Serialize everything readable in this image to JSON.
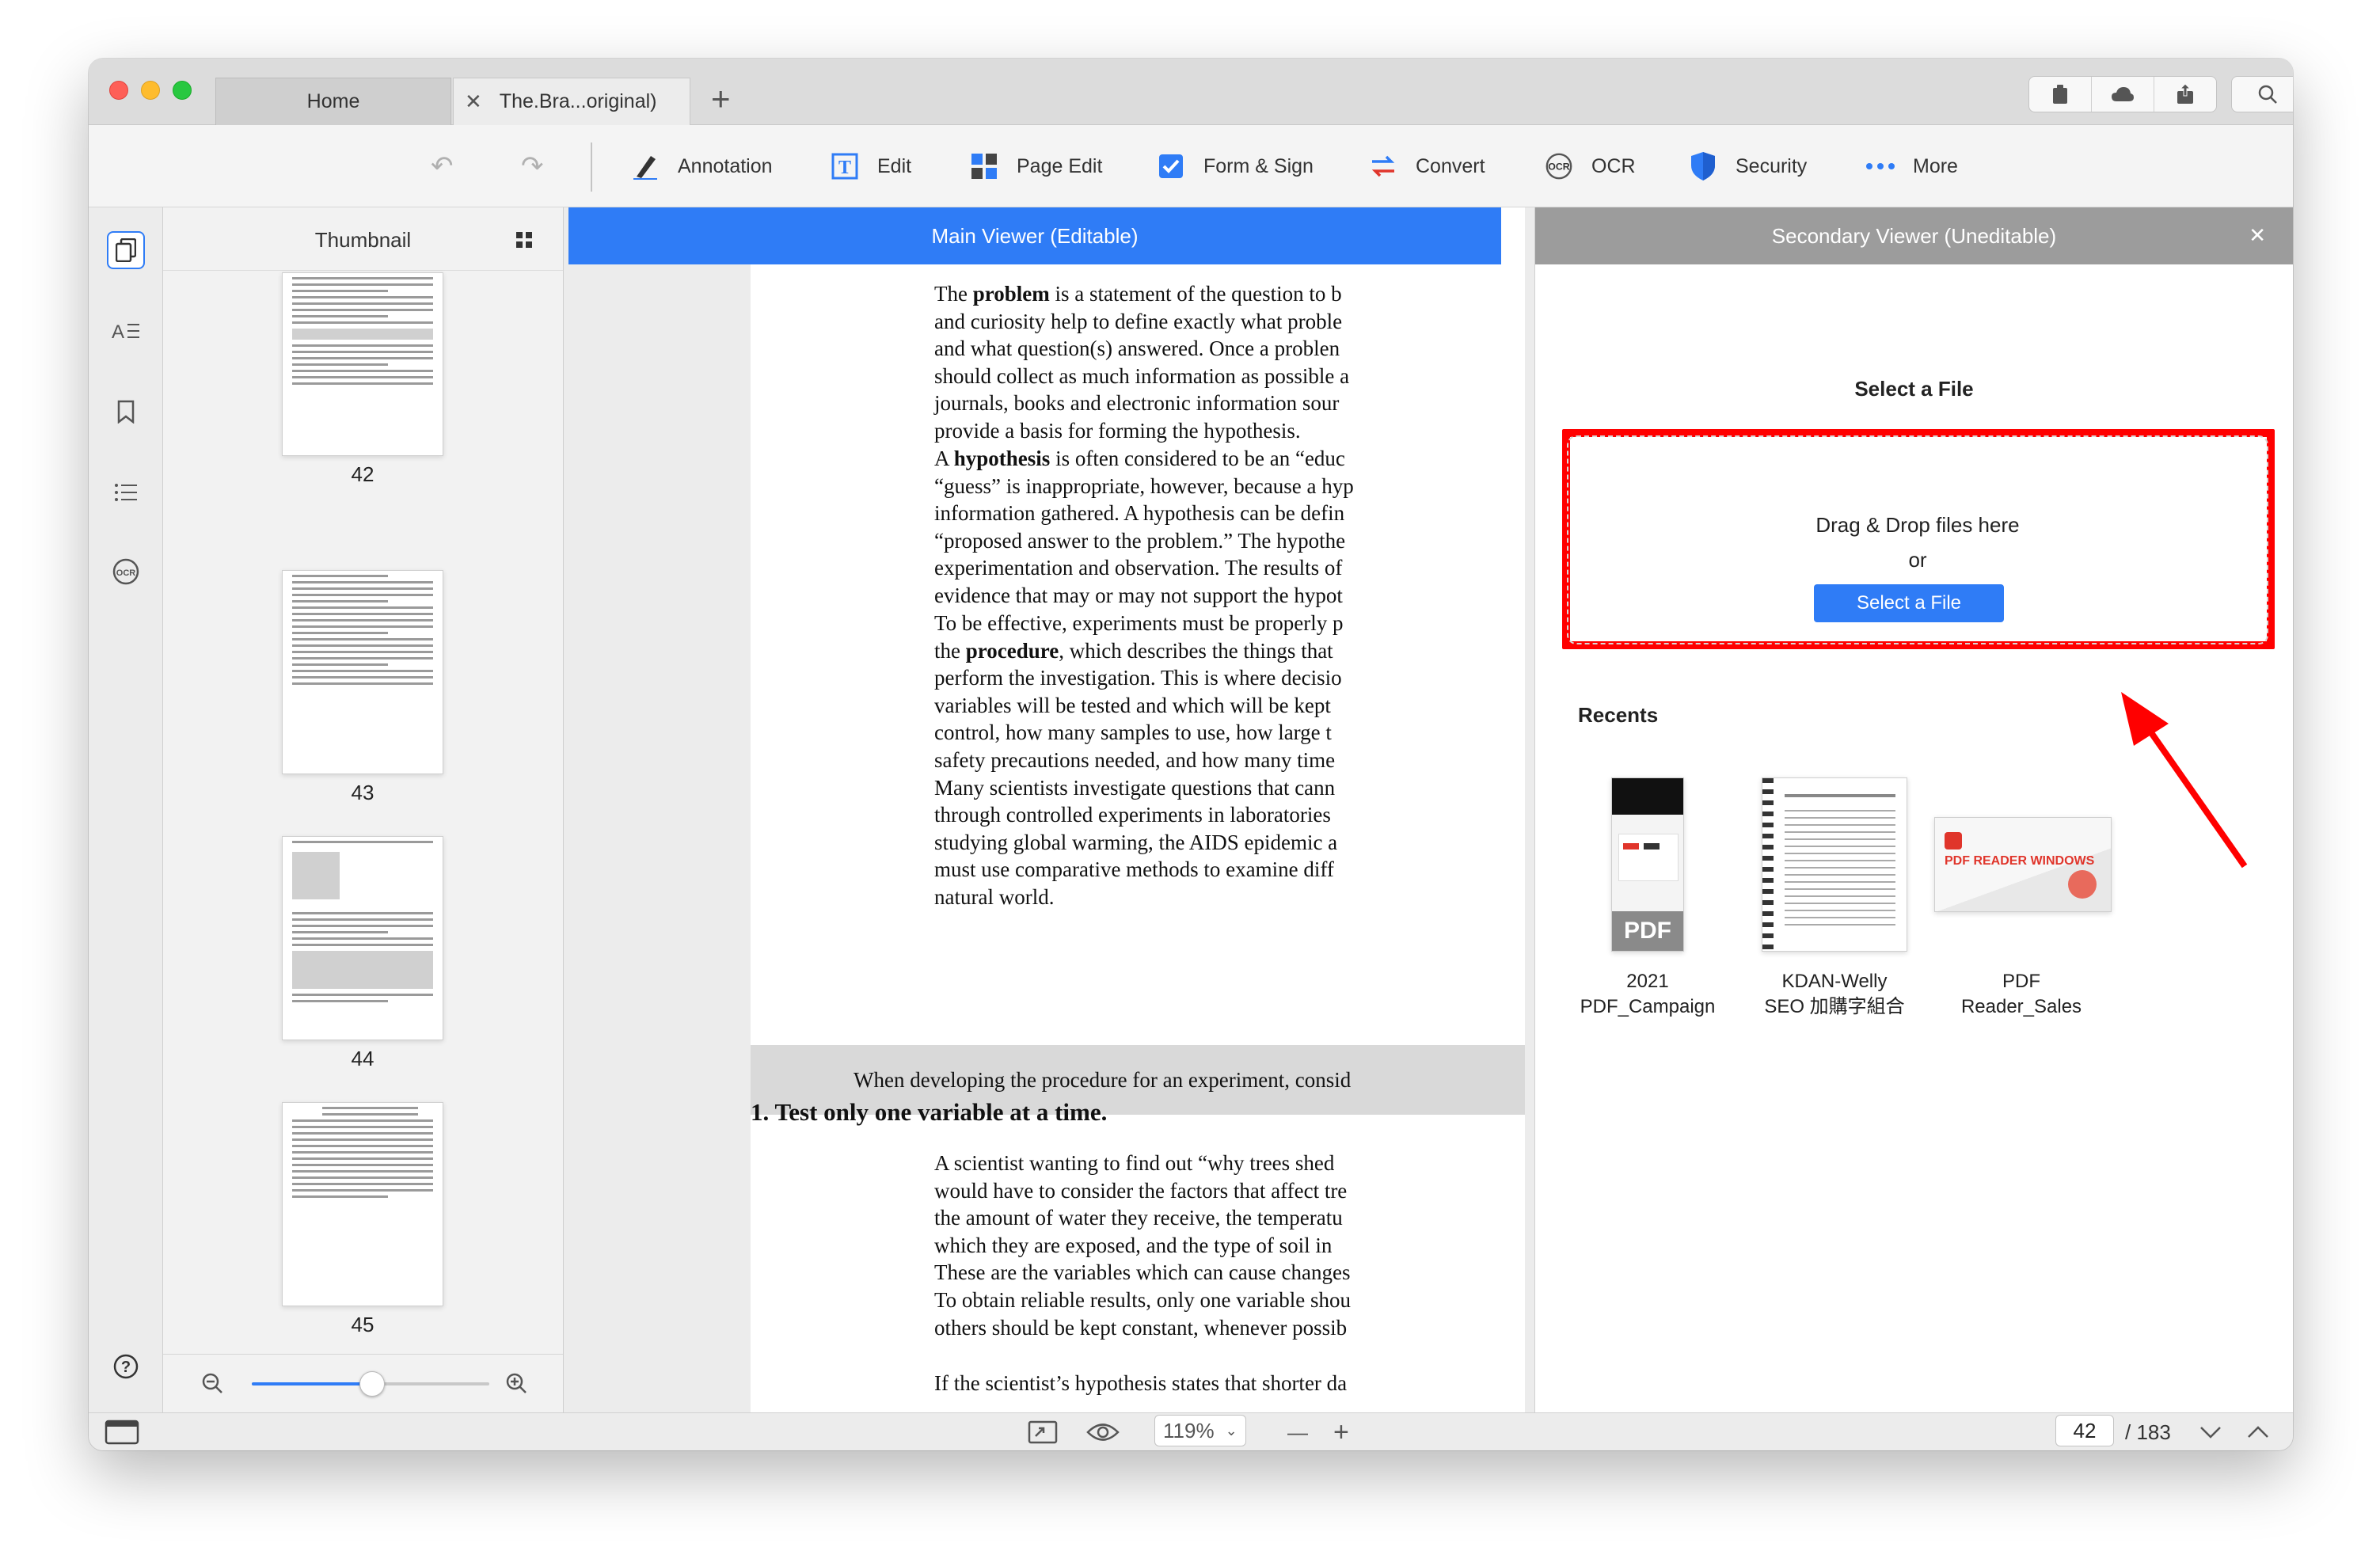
{
  "tabs": {
    "home": "Home",
    "document": "The.Bra...original)"
  },
  "toolbar": {
    "annotation": "Annotation",
    "edit": "Edit",
    "page_edit": "Page Edit",
    "form_sign": "Form & Sign",
    "convert": "Convert",
    "ocr": "OCR",
    "security": "Security",
    "more": "More"
  },
  "thumbnail_panel": {
    "title": "Thumbnail",
    "pages": [
      "42",
      "43",
      "44",
      "45"
    ]
  },
  "main_viewer": {
    "header": "Main Viewer (Editable)",
    "p1": [
      "The problem is a statement of the question to b",
      "and curiosity help to define exactly what proble",
      "and what question(s) answered. Once a problen",
      "should collect as much information as possible a",
      "journals, books and electronic information sour",
      "provide a basis for forming the hypothesis."
    ],
    "p2": [
      "A hypothesis is often considered to be an “educ",
      "“guess” is inappropriate, however, because a hyp",
      "information gathered. A hypothesis can be defin",
      "“proposed answer to the problem.” The hypothe",
      "experimentation and observation. The results of",
      "evidence that may or may not support the hypot"
    ],
    "p3": [
      "To be effective, experiments must be properly p",
      "the procedure, which describes the things that",
      "perform the investigation. This is where decisio",
      "variables will be tested and which will be kept",
      "control, how many samples to use, how large t",
      "safety precautions needed, and how many time",
      "Many scientists investigate questions that cann",
      "through controlled experiments in laboratories",
      "studying global warming, the AIDS epidemic a",
      "must use comparative methods to examine diff",
      "natural world."
    ],
    "callout": "When developing the procedure for an experiment, consid",
    "heading": "1.  Test only one variable at a time.",
    "p4": [
      "A scientist wanting to find out “why trees shed",
      "would have to consider the factors that affect tre",
      "the amount of water they receive, the temperatu",
      "which they are exposed, and the type of soil in",
      "These are the variables which can cause changes",
      "To obtain reliable results, only one variable shou",
      "others should be kept constant, whenever possib"
    ],
    "p5": "If the scientist’s hypothesis states that shorter da"
  },
  "secondary_viewer": {
    "header": "Secondary Viewer (Uneditable)",
    "select_title": "Select a File",
    "drop_text": "Drag & Drop files here",
    "or": "or",
    "button": "Select a File",
    "recents_title": "Recents",
    "recents": [
      {
        "line1": "2021",
        "line2": "PDF_Campaign"
      },
      {
        "line1": "KDAN-Welly",
        "line2": "SEO 加購字組合"
      },
      {
        "line1": "PDF",
        "line2": "Reader_Sales"
      }
    ],
    "pdf_badge": "PDF",
    "banner_text": "PDF READER WINDOWS"
  },
  "bottom_bar": {
    "zoom": "119%",
    "page_current": "42",
    "page_total": "/ 183"
  },
  "colors": {
    "accent": "#2f7cf6",
    "highlight": "#ff0000",
    "secondary_header": "#9c9c9c"
  }
}
